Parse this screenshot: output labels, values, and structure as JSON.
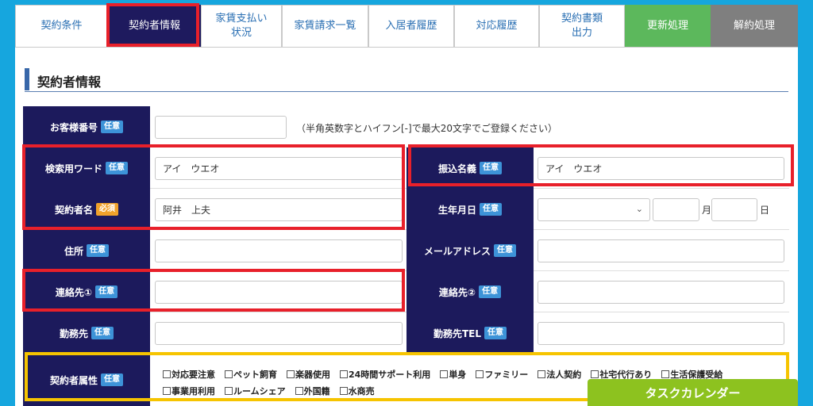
{
  "tabs": [
    {
      "label": "契約条件"
    },
    {
      "label": "契約者情報"
    },
    {
      "label": "家賃支払い\n状況"
    },
    {
      "label": "家賃請求一覧"
    },
    {
      "label": "入居者履歴"
    },
    {
      "label": "対応履歴"
    },
    {
      "label": "契約書類\n出力"
    },
    {
      "label": "更新処理"
    },
    {
      "label": "解約処理"
    }
  ],
  "section_title": "契約者情報",
  "badges": {
    "optional": "任意",
    "required": "必須"
  },
  "fields": {
    "customer_no": {
      "label": "お客様番号",
      "value": "",
      "hint": "（半角英数字とハイフン[-]で最大20文字でご登録ください）"
    },
    "search_word": {
      "label": "検索用ワード",
      "value": "アイ　ウエオ"
    },
    "transfer_name": {
      "label": "振込名義",
      "value": "アイ　ウエオ"
    },
    "contractor_name": {
      "label": "契約者名",
      "value": "阿井　上夫"
    },
    "birthday": {
      "label": "生年月日",
      "year": "",
      "month": "",
      "month_unit": "月",
      "day": "",
      "day_unit": "日"
    },
    "address": {
      "label": "住所",
      "value": ""
    },
    "email": {
      "label": "メールアドレス",
      "value": ""
    },
    "contact1": {
      "label": "連絡先①",
      "value": ""
    },
    "contact2": {
      "label": "連絡先②",
      "value": ""
    },
    "workplace": {
      "label": "勤務先",
      "value": ""
    },
    "workplace_tel": {
      "label": "勤務先TEL",
      "value": ""
    },
    "attributes": {
      "label": "契約者属性",
      "options_line1": [
        "対応要注意",
        "ペット飼育",
        "楽器使用",
        "24時間サポート利用",
        "単身",
        "ファミリー",
        "法人契約",
        "社宅代行あり",
        "生活保護受給"
      ],
      "options_line2": [
        "事業用利用",
        "ルームシェア",
        "外国籍",
        "水商売"
      ]
    }
  },
  "task_calendar": "タスクカレンダー",
  "colors": {
    "background": "#16a6de",
    "label_bg": "#1c1a5c",
    "active_tab": "#1e1a5e",
    "renew_tab": "#5cb85c",
    "cancel_tab": "#7f7f7f",
    "highlight_red": "#e8202a",
    "highlight_yellow": "#f6c400",
    "task_button": "#8dc21f"
  }
}
